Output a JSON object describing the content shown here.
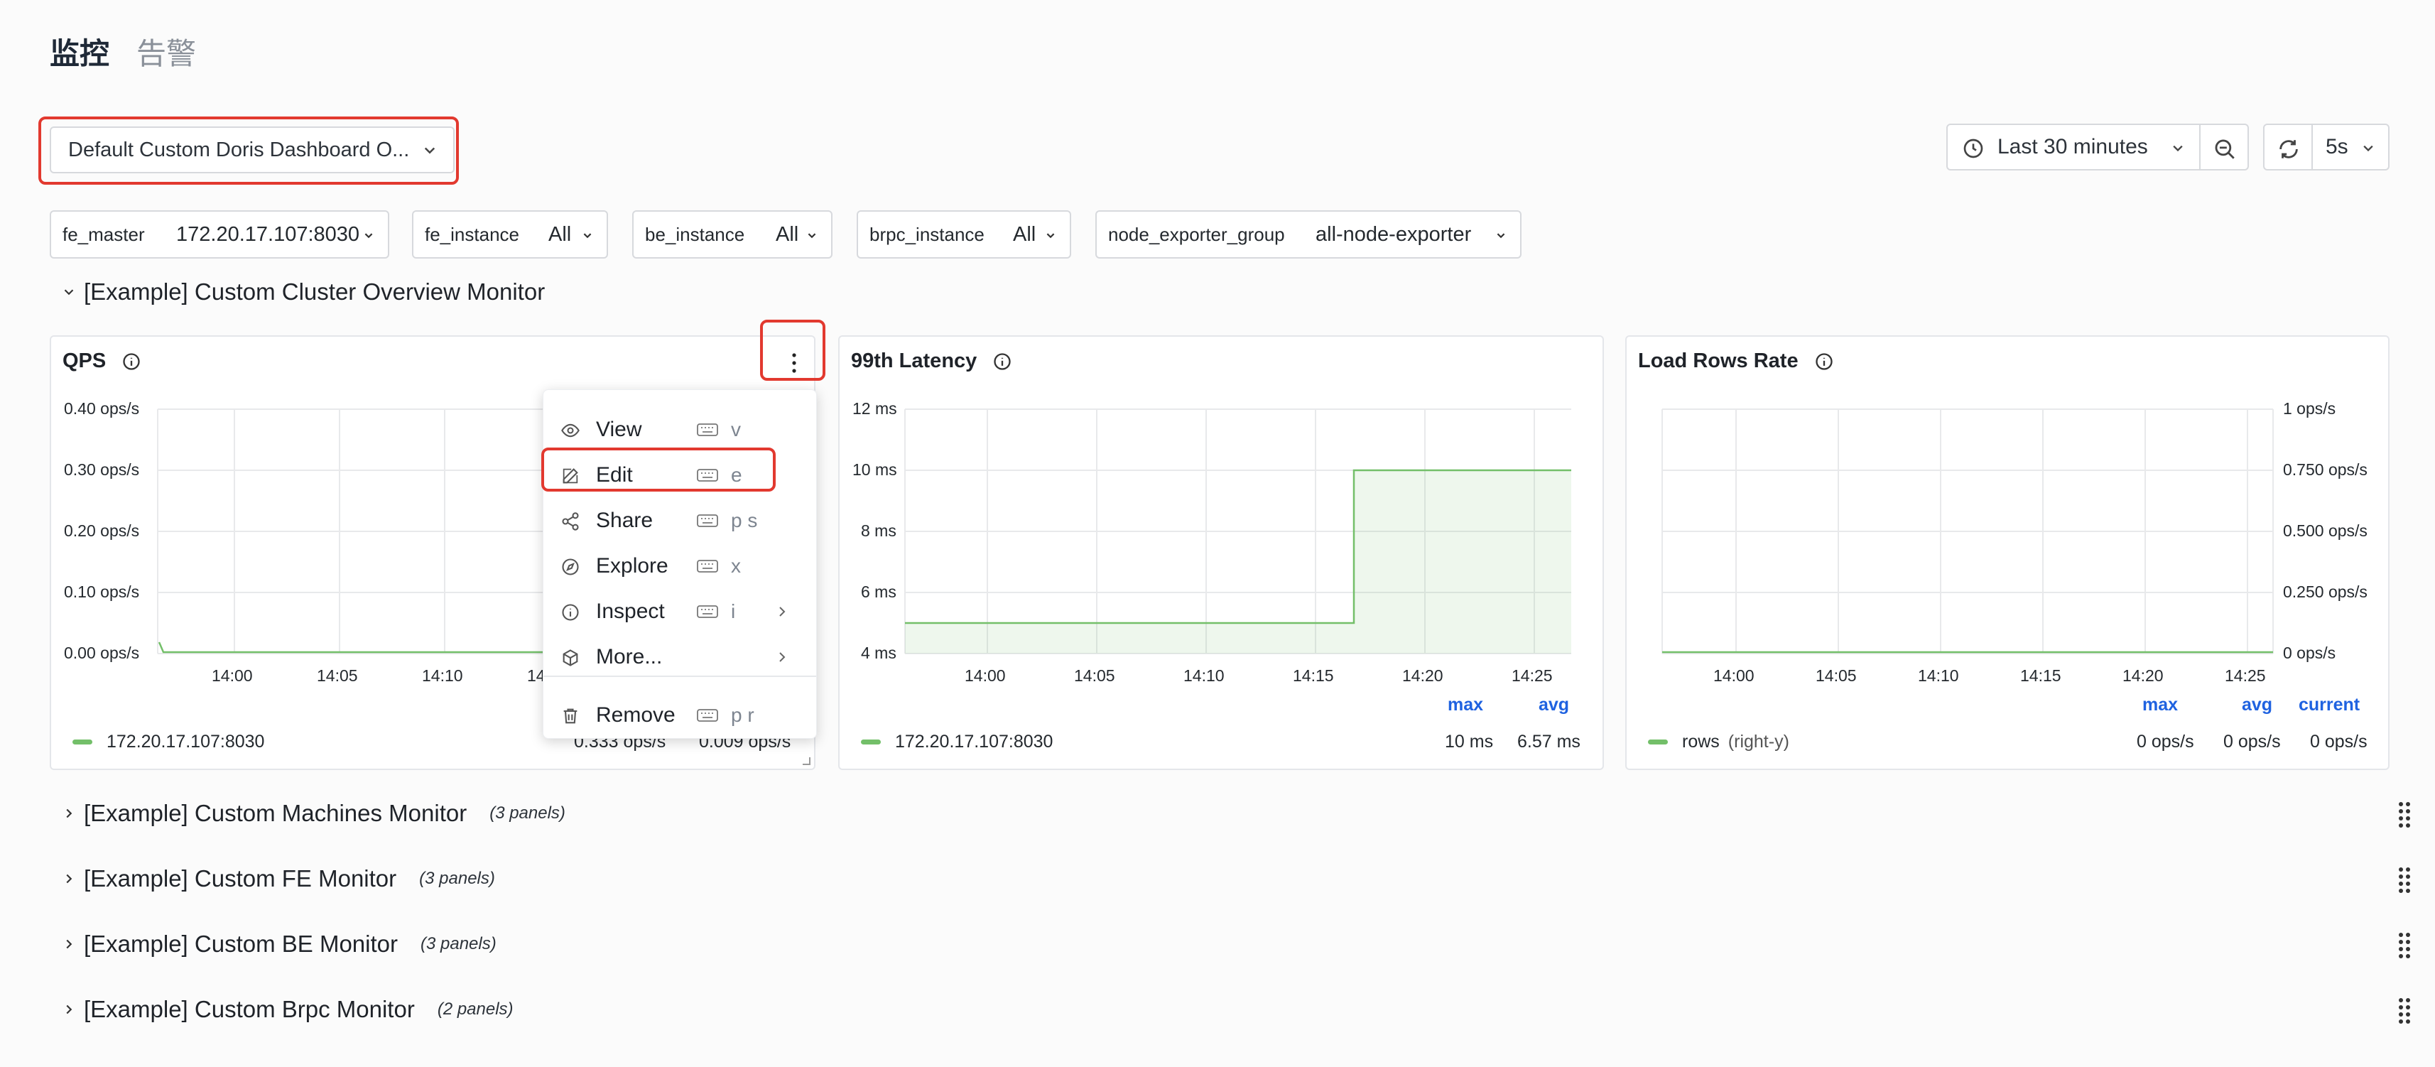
{
  "tabs": {
    "monitor": "监控",
    "alerts": "告警"
  },
  "dashboard_picker": {
    "value": "Default Custom Doris Dashboard O..."
  },
  "time": {
    "range": "Last 30 minutes",
    "refresh_interval": "5s"
  },
  "variables": [
    {
      "name": "fe_master",
      "value": "172.20.17.107:8030"
    },
    {
      "name": "fe_instance",
      "value": "All"
    },
    {
      "name": "be_instance",
      "value": "All"
    },
    {
      "name": "brpc_instance",
      "value": "All"
    },
    {
      "name": "node_exporter_group",
      "value": "all-node-exporter"
    }
  ],
  "section_open": {
    "title": "[Example] Custom Cluster Overview Monitor"
  },
  "panels": {
    "qps": {
      "title": "QPS",
      "y_ticks": [
        "0.40 ops/s",
        "0.30 ops/s",
        "0.20 ops/s",
        "0.10 ops/s",
        "0.00 ops/s"
      ],
      "x_ticks": [
        "14:00",
        "14:05",
        "14:10",
        "14"
      ],
      "legend_series": "172.20.17.107:8030",
      "legend_max": "0.333 ops/s",
      "legend_avg": "0.009 ops/s"
    },
    "latency": {
      "title": "99th Latency",
      "y_ticks": [
        "12 ms",
        "10 ms",
        "8 ms",
        "6 ms",
        "4 ms"
      ],
      "x_ticks": [
        "14:00",
        "14:05",
        "14:10",
        "14:15",
        "14:20",
        "14:25"
      ],
      "stat_headers": {
        "max": "max",
        "avg": "avg"
      },
      "legend_series": "172.20.17.107:8030",
      "legend_max": "10 ms",
      "legend_avg": "6.57 ms"
    },
    "load_rows": {
      "title": "Load Rows Rate",
      "y_ticks": [
        "1 ops/s",
        "0.750 ops/s",
        "0.500 ops/s",
        "0.250 ops/s",
        "0 ops/s"
      ],
      "x_ticks": [
        "14:00",
        "14:05",
        "14:10",
        "14:15",
        "14:20",
        "14:25"
      ],
      "stat_headers": {
        "max": "max",
        "avg": "avg",
        "current": "current"
      },
      "legend_series": "rows",
      "legend_axis": "(right-y)",
      "legend_max": "0 ops/s",
      "legend_avg": "0 ops/s",
      "legend_current": "0 ops/s"
    }
  },
  "chart_data": [
    {
      "type": "line",
      "title": "99th Latency",
      "x": [
        "14:00",
        "14:05",
        "14:10",
        "14:15",
        "14:17",
        "14:20",
        "14:25"
      ],
      "series": [
        {
          "name": "172.20.17.107:8030",
          "values": [
            5,
            5,
            5,
            5,
            10,
            10,
            10
          ]
        }
      ],
      "ylim": [
        4,
        12
      ]
    },
    {
      "type": "line",
      "title": "Load Rows Rate",
      "x": [
        "14:00",
        "14:05",
        "14:10",
        "14:15",
        "14:20",
        "14:25"
      ],
      "series": [
        {
          "name": "rows",
          "values": [
            0,
            0,
            0,
            0,
            0,
            0
          ]
        }
      ],
      "ylim": [
        0,
        1
      ]
    },
    {
      "type": "line",
      "title": "QPS",
      "x": [
        "14:00",
        "14:05",
        "14:10"
      ],
      "series": [
        {
          "name": "172.20.17.107:8030",
          "values": [
            0,
            0,
            0
          ]
        }
      ],
      "ylim": [
        0,
        0.4
      ]
    }
  ],
  "menu": {
    "items": [
      {
        "label": "View",
        "shortcut": "v"
      },
      {
        "label": "Edit",
        "shortcut": "e"
      },
      {
        "label": "Share",
        "shortcut": "p s"
      },
      {
        "label": "Explore",
        "shortcut": "x"
      },
      {
        "label": "Inspect",
        "shortcut": "i"
      },
      {
        "label": "More..."
      },
      {
        "label": "Remove",
        "shortcut": "p r"
      }
    ]
  },
  "collapsed_sections": [
    {
      "title": "[Example] Custom Machines Monitor",
      "count": "(3 panels)"
    },
    {
      "title": "[Example] Custom FE Monitor",
      "count": "(3 panels)"
    },
    {
      "title": "[Example] Custom BE Monitor",
      "count": "(3 panels)"
    },
    {
      "title": "[Example] Custom Brpc Monitor",
      "count": "(2 panels)"
    }
  ],
  "colors": {
    "series": "#73bf69",
    "highlight": "#e2392f",
    "stat_header": "#1f62e0"
  }
}
